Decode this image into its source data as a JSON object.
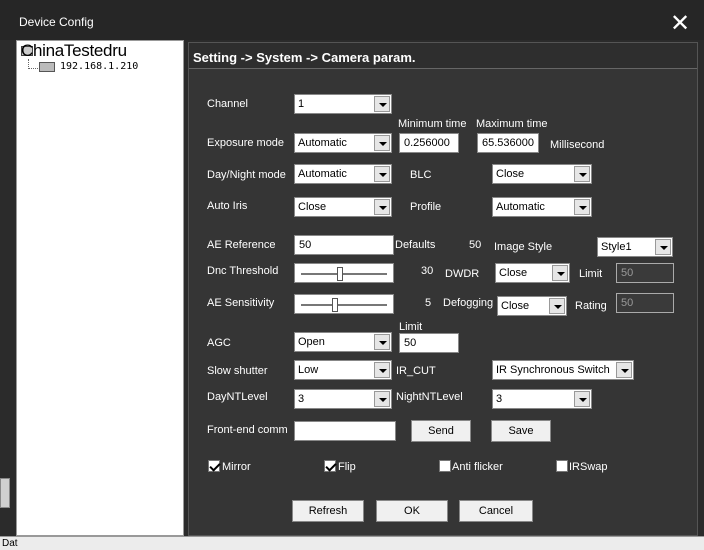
{
  "window": {
    "title": "Device Config",
    "close_glyph": "✕"
  },
  "tree": {
    "root": "ChinaTestedru",
    "device_ip": "192.168.1.210"
  },
  "breadcrumb": "Setting -> System -> Camera param.",
  "fields": {
    "channel": {
      "label": "Channel",
      "value": "1"
    },
    "min_time_label": "Minimum time",
    "max_time_label": "Maximum time",
    "exposure": {
      "label": "Exposure mode",
      "value": "Automatic",
      "min": "0.256000",
      "max": "65.536000",
      "unit": "Millisecond"
    },
    "day_night": {
      "label": "Day/Night mode",
      "value": "Automatic"
    },
    "blc": {
      "label": "BLC",
      "value": "Close"
    },
    "auto_iris": {
      "label": "Auto Iris",
      "value": "Close"
    },
    "profile": {
      "label": "Profile",
      "value": "Automatic"
    },
    "ae_reference": {
      "label": "AE Reference",
      "value": "50",
      "defaults_label": "Defaults",
      "defaults_value": "50"
    },
    "image_style": {
      "label": "Image Style",
      "value": "Style1"
    },
    "dnc_threshold": {
      "label": "Dnc Threshold",
      "value": "30",
      "level": 0.45
    },
    "dwdr": {
      "label": "DWDR",
      "value": "Close",
      "limit_label": "Limit",
      "limit_value": "50"
    },
    "ae_sensitivity": {
      "label": "AE Sensitivity",
      "value": "5",
      "level": 0.4
    },
    "defogging": {
      "label": "Defogging",
      "value": "Close",
      "rating_label": "Rating",
      "rating_value": "50"
    },
    "agc": {
      "label": "AGC",
      "value": "Open",
      "limit_label": "Limit",
      "limit_value": "50"
    },
    "slow_shutter": {
      "label": "Slow shutter",
      "value": "Low"
    },
    "ir_cut": {
      "label": "IR_CUT",
      "value": "IR Synchronous Switch"
    },
    "day_nt_level": {
      "label": "DayNTLevel",
      "value": "3"
    },
    "night_nt_level": {
      "label": "NightNTLevel",
      "value": "3"
    },
    "front_end": {
      "label": "Front-end comm",
      "value": ""
    }
  },
  "buttons": {
    "send": "Send",
    "save": "Save",
    "refresh": "Refresh",
    "ok": "OK",
    "cancel": "Cancel"
  },
  "checks": {
    "mirror": {
      "label": "Mirror",
      "checked": true
    },
    "flip": {
      "label": "Flip",
      "checked": true
    },
    "anti_flicker": {
      "label": "Anti flicker",
      "checked": false
    },
    "irswap": {
      "label": "IRSwap",
      "checked": false
    }
  },
  "statusbar": {
    "left": "Dat"
  }
}
